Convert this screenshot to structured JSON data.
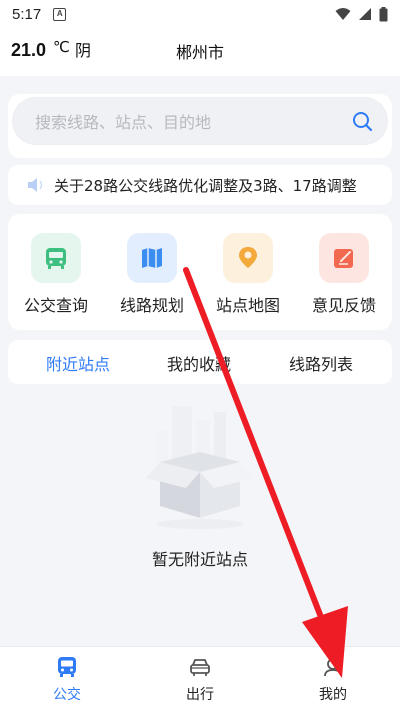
{
  "status_bar": {
    "time": "5:17",
    "badge": "A"
  },
  "header": {
    "temperature": "21.0",
    "unit": "℃",
    "weather": "阴",
    "city": "郴州市"
  },
  "search": {
    "placeholder": "搜索线路、站点、目的地"
  },
  "notice": {
    "text": "关于28路公交线路优化调整及3路、17路调整"
  },
  "functions": [
    {
      "label": "公交查询",
      "icon": "bus-icon",
      "color": "#3fbf7f",
      "bg": "#e5f6ee"
    },
    {
      "label": "线路规划",
      "icon": "map-icon",
      "color": "#3b8df0",
      "bg": "#e2eefd"
    },
    {
      "label": "站点地图",
      "icon": "location-pin-icon",
      "color": "#f3a93b",
      "bg": "#fdf1de"
    },
    {
      "label": "意见反馈",
      "icon": "feedback-icon",
      "color": "#f2694f",
      "bg": "#fde6e1"
    }
  ],
  "tabs": [
    {
      "label": "附近站点",
      "active": true
    },
    {
      "label": "我的收藏",
      "active": false
    },
    {
      "label": "线路列表",
      "active": false
    }
  ],
  "empty_state": {
    "text": "暂无附近站点"
  },
  "bottom_nav": [
    {
      "label": "公交",
      "icon": "bus-icon",
      "active": true
    },
    {
      "label": "出行",
      "icon": "car-icon",
      "active": false
    },
    {
      "label": "我的",
      "icon": "profile-icon",
      "active": false
    }
  ],
  "colors": {
    "accent": "#2f7bf5",
    "annotation": "#ee1c24"
  }
}
